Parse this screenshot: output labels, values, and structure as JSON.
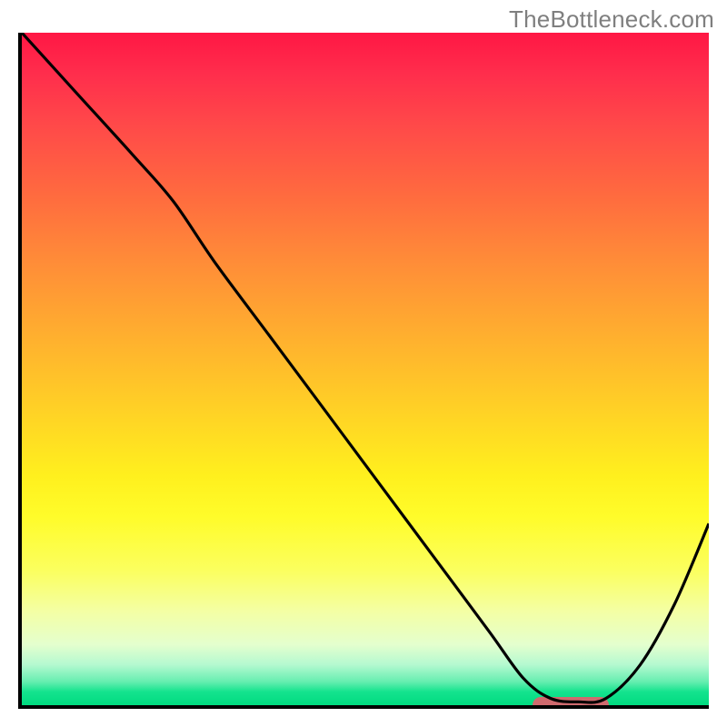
{
  "watermark": "TheBottleneck.com",
  "chart_data": {
    "type": "line",
    "title": "",
    "xlabel": "",
    "ylabel": "",
    "xlim": [
      0,
      100
    ],
    "ylim": [
      0,
      100
    ],
    "x": [
      0,
      8,
      16,
      22,
      28,
      36,
      44,
      52,
      60,
      68,
      73,
      77,
      81,
      85,
      90,
      95,
      100
    ],
    "values": [
      100,
      91,
      82,
      75,
      66,
      55,
      44,
      33,
      22,
      11,
      4,
      1,
      0.5,
      1,
      6,
      15,
      27
    ],
    "background_gradient": {
      "top_color": "#ff1744",
      "bottom_color": "#00db80",
      "stops": [
        "red",
        "orange",
        "yellow",
        "pale-yellow",
        "green"
      ]
    },
    "marker": {
      "x_start": 74,
      "x_end": 85,
      "y": 0.6,
      "color": "#cf6a6e"
    }
  }
}
